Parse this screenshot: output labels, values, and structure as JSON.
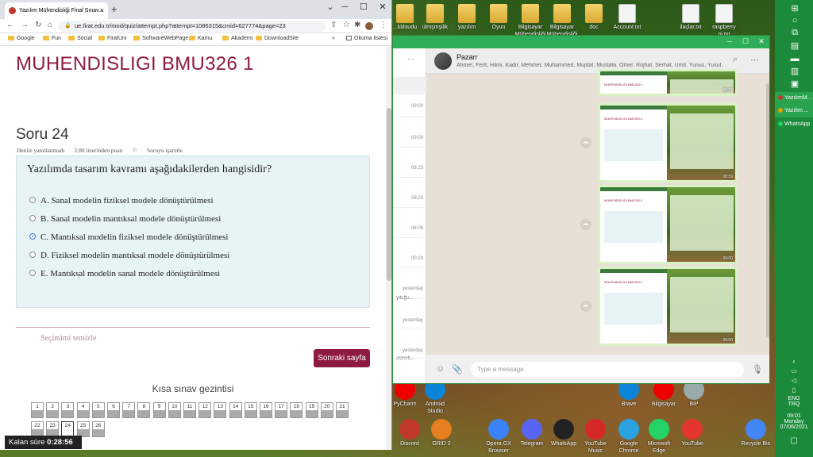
{
  "desktop_icons": [
    {
      "label": "...kkloudu",
      "kind": "folder"
    },
    {
      "label": "ülmşmşilik",
      "kind": "folder"
    },
    {
      "label": "yazılım",
      "kind": "folder"
    },
    {
      "label": "Oyun",
      "kind": "folder"
    },
    {
      "label": "Bilgisayar Mühendisliği",
      "kind": "folder"
    },
    {
      "label": "Bilgisayar Mühendisliği",
      "kind": "folder"
    },
    {
      "label": "doc",
      "kind": "folder"
    },
    {
      "label": "Account.txt",
      "kind": "file"
    },
    {
      "label": "ilaçlar.txt",
      "kind": "file"
    },
    {
      "label": "raspberry pi.txt",
      "kind": "file"
    },
    {
      "label": "Brave",
      "kind": "app"
    },
    {
      "label": "Bilgisayar",
      "kind": "app"
    },
    {
      "label": "BiP",
      "kind": "app"
    },
    {
      "label": "Discord",
      "kind": "app"
    },
    {
      "label": "GRID 2",
      "kind": "app"
    },
    {
      "label": "Opera GX Browser",
      "kind": "app"
    },
    {
      "label": "Telegram",
      "kind": "app"
    },
    {
      "label": "WhatsApp",
      "kind": "app"
    },
    {
      "label": "YouTube Music",
      "kind": "app"
    },
    {
      "label": "Google Chrome",
      "kind": "app"
    },
    {
      "label": "Microsoft Edge",
      "kind": "app"
    },
    {
      "label": "YouTube",
      "kind": "app"
    },
    {
      "label": "Recycle Bin",
      "kind": "app"
    },
    {
      "label": "Android Studio",
      "kind": "app"
    },
    {
      "label": "PyCharm",
      "kind": "app"
    }
  ],
  "taskbar": {
    "apps": [
      {
        "label": "YazılımM...",
        "color": "#c0392b"
      },
      {
        "label": "Yazılım ...",
        "color": "#e6a100"
      },
      {
        "label": "WhatsApp",
        "color": "#25d366"
      }
    ],
    "tray": {
      "lang": "ENG",
      "region": "TRQ",
      "time": "09:01",
      "day": "Monday",
      "date": "07/06/2021"
    }
  },
  "chrome": {
    "tab_title": "Yazılım Mühendisliği Final Sınav...",
    "tab_close": "×",
    "new_tab": "+",
    "minimize": "─",
    "maximize": "☐",
    "close": "✕",
    "back": "←",
    "forward": "→",
    "reload": "↻",
    "lock": "🔒",
    "url": "ue.firat.edu.tr/mod/quiz/attempt.php?attempt=1086315&cmid=627774&page=23",
    "bookmarks": [
      "Google",
      "Fun",
      "Social",
      "FiratUni",
      "SoftwareWebPage",
      "Kamu",
      "Akademi",
      "DownloadSite"
    ],
    "more": "»",
    "reading_list": "Okuma listesi"
  },
  "quiz": {
    "course_title": "MUHENDISLIGI BMU326 1",
    "question_title": "Soru 24",
    "status": "Henüz yanıtlanmadı",
    "points": "2.80 üzerinden puan",
    "flag": "Soruyu işaretle",
    "question_text": "Yazılımda tasarım kavramı aşağıdakilerden hangisidir?",
    "options": [
      {
        "label": "A. Sanal modelin fiziksel modele dönüştürülmesi",
        "checked": false
      },
      {
        "label": "B. Sanal modelin mantıksal modele dönüştürülmesi",
        "checked": false
      },
      {
        "label": "C. Mantıksal modelin fiziksel modele dönüştürülmesi",
        "checked": true
      },
      {
        "label": "D. Fiziksel modelin mantıksal modele dönüştürülmesi",
        "checked": false
      },
      {
        "label": "E. Mantıksal modelin sanal modele dönüştürülmesi",
        "checked": false
      }
    ],
    "clear_choice": "Seçimimi temizle",
    "next_button": "Sonraki sayfa",
    "nav_title": "Kısa sınav gezintisi",
    "nav_pages": [
      "1",
      "2",
      "3",
      "4",
      "5",
      "6",
      "7",
      "8",
      "9",
      "10",
      "11",
      "12",
      "13",
      "14",
      "15",
      "16",
      "17",
      "18",
      "19",
      "20",
      "21",
      "22",
      "23",
      "24",
      "25",
      "26"
    ],
    "current_page": "24",
    "timer_label": "Kalan süre",
    "timer_value": "0:28:56"
  },
  "whatsapp": {
    "group_name": "Pazarr",
    "members": "Ahmet, Ferit, Hilmi, Kadir, Mehmet, Muhammed, Mujdat, Mustafa, Ömer, Rojhat, Serhat, Ümit, Yunus, Yusuf, ...",
    "list_times": [
      "09:00",
      "09:00",
      "08:23",
      "08:23",
      "08:06",
      "00:28",
      "yesterday",
      "yesterday",
      "yesterday"
    ],
    "list_snippets": [
      "yduğu...",
      "askerli..."
    ],
    "image_stamps": [
      "08:57",
      "08:59",
      "09:00",
      "09:00"
    ],
    "mini_title": "MUHENDISLIGI BMU326 1",
    "compose_placeholder": "Type a message",
    "search": "⌕",
    "menu": "⋯",
    "emoji": "☺",
    "attach": "📎",
    "mic": "🎙",
    "forward": "➦"
  }
}
